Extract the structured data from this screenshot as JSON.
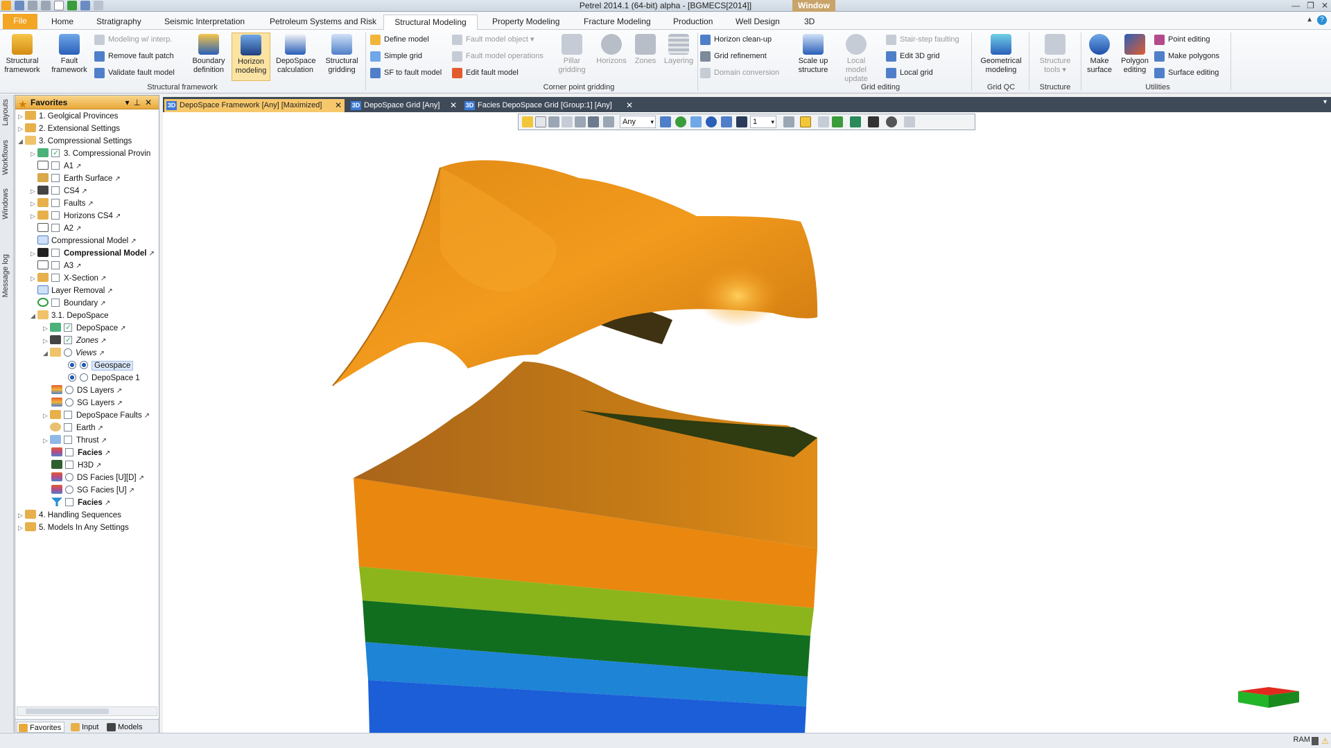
{
  "window": {
    "title": "Petrel 2014.1 (64-bit) alpha - [BGMECS[2014]]",
    "window_tag": "Window"
  },
  "menu": {
    "file": "File",
    "tabs": [
      "Home",
      "Stratigraphy",
      "Seismic Interpretation",
      "Petroleum Systems and Risk",
      "Structural Modeling",
      "Property Modeling",
      "Fracture Modeling",
      "Production",
      "Well Design",
      "3D"
    ]
  },
  "ribbon": {
    "structural_framework": {
      "label": "Structural framework",
      "structural_framework": "Structural framework",
      "fault_framework": "Fault framework",
      "modeling_interp": "Modeling w/ interp.",
      "remove_fault_patch": "Remove fault patch",
      "validate_fault_model": "Validate fault model",
      "boundary_definition": "Boundary definition",
      "horizon_modeling": "Horizon modeling",
      "depospace_calculation": "DepoSpace calculation",
      "structural_gridding": "Structural gridding"
    },
    "corner_point": {
      "label": "Corner point gridding",
      "define_model": "Define model",
      "simple_grid": "Simple grid",
      "sf_to_fault_model": "SF to fault model",
      "fault_model_object": "Fault model object",
      "fault_model_operations": "Fault model operations",
      "edit_fault_model": "Edit fault model",
      "pillar_gridding": "Pillar gridding",
      "horizons": "Horizons",
      "zones": "Zones",
      "layering": "Layering"
    },
    "grid_editing": {
      "label": "Grid editing",
      "horizon_cleanup": "Horizon clean-up",
      "grid_refinement": "Grid refinement",
      "domain_conversion": "Domain conversion",
      "scale_up_structure": "Scale up structure",
      "local_model_update": "Local model update",
      "stair_step_faulting": "Stair-step faulting",
      "edit_3d_grid": "Edit 3D grid",
      "local_grid": "Local grid"
    },
    "grid_qc": {
      "label": "Grid QC",
      "geometrical_modeling": "Geometrical modeling"
    },
    "structure": {
      "label": "Structure",
      "structure_tools": "Structure tools"
    },
    "utilities": {
      "label": "Utilities",
      "make_surface": "Make surface",
      "polygon_editing": "Polygon editing",
      "point_editing": "Point editing",
      "make_polygons": "Make polygons",
      "surface_editing": "Surface editing"
    }
  },
  "left_rail": [
    "Layouts",
    "Workflows",
    "Windows",
    "Message log"
  ],
  "favorites": {
    "title": "Favorites",
    "nodes": [
      {
        "label": "1. Geolgical Provinces"
      },
      {
        "label": "2. Extensional Settings"
      },
      {
        "label": "3. Compressional Settings"
      },
      {
        "label": "3. Compressional Provin"
      },
      {
        "label": "A1"
      },
      {
        "label": "Earth Surface"
      },
      {
        "label": "CS4"
      },
      {
        "label": "Faults"
      },
      {
        "label": "Horizons CS4"
      },
      {
        "label": "A2"
      },
      {
        "label": "Compressional Model"
      },
      {
        "label": "Compressional Model"
      },
      {
        "label": "A3"
      },
      {
        "label": "X-Section"
      },
      {
        "label": "Layer Removal"
      },
      {
        "label": "Boundary"
      },
      {
        "label": "3.1. DepoSpace"
      },
      {
        "label": "DepoSpace"
      },
      {
        "label": "Zones"
      },
      {
        "label": "Views"
      },
      {
        "label": "Geospace"
      },
      {
        "label": "DepoSpace 1"
      },
      {
        "label": "DS Layers"
      },
      {
        "label": "SG Layers"
      },
      {
        "label": "DepoSpace Faults"
      },
      {
        "label": "Earth"
      },
      {
        "label": "Thrust"
      },
      {
        "label": "Facies"
      },
      {
        "label": "H3D"
      },
      {
        "label": "DS Facies [U][D]"
      },
      {
        "label": "SG Facies [U]"
      },
      {
        "label": "Facies"
      },
      {
        "label": "4. Handling Sequences"
      },
      {
        "label": "5. Models In Any Settings"
      }
    ],
    "bottom_tabs": [
      "Favorites",
      "Input",
      "Models"
    ]
  },
  "doc_tabs": [
    "DepoSpace Framework [Any] [Maximized]",
    "DepoSpace Grid [Any]",
    "Facies DepoSpace Grid [Group:1] [Any]"
  ],
  "viewer_toolbar": {
    "domain": "Any",
    "zscale": "1"
  },
  "status": {
    "ram": "RAM"
  }
}
